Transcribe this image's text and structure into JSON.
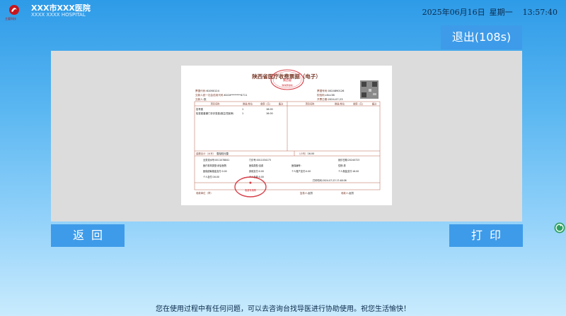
{
  "header": {
    "logo_caption": "主要科技",
    "hospital_name": "XXX市XXX医院",
    "hospital_en": "XXXX XXXX HOSPITAL",
    "date": "2025年06月16日",
    "weekday": "星期一",
    "time": "13:57:40"
  },
  "exit_label": "退出(108s)",
  "invoice": {
    "title": "陕西省医疗收费票据（电子）",
    "seal_text": "陕西省",
    "seal_sub": "财政部监制",
    "left_meta": [
      {
        "label": "票据代码:",
        "value": "61060124"
      },
      {
        "label": "交款人统一社会信用代码:",
        "value": "6104********4711"
      },
      {
        "label": "交款人:",
        "value": "张"
      }
    ],
    "right_meta": [
      {
        "label": "票据号码:",
        "value": "0024890126"
      },
      {
        "label": "校验码:",
        "value": "c0cc38"
      },
      {
        "label": "开票日期:",
        "value": "2024-07-23"
      }
    ],
    "col_headers": [
      "项目名称",
      "数量/单位",
      "金额（元）",
      "备注",
      "项目名称",
      "数量/单位",
      "金额（元）",
      "备注"
    ],
    "rows": [
      {
        "name": "挂号费",
        "qty": "1",
        "amount": "16.00"
      },
      {
        "name": "检查费普通门诊诊查费(副主任医师)",
        "qty": "1",
        "amount": "16.00"
      }
    ],
    "total_label": "金额合计（大写）",
    "total_upper": "壹拾陆元整",
    "total_small_label": "（小写）",
    "total_small": "16.00",
    "other": [
      [
        "业务流水号:",
        "0011078841",
        "门诊号:",
        "0011034173",
        "就诊日期:",
        "20240723"
      ],
      [
        "医疗机构类型:",
        "综合医院",
        "医保类型:",
        "自费",
        "医保编号:",
        "",
        "性别:",
        "男"
      ],
      [
        "医保统筹基金支付:",
        "0.00",
        "其他支付:",
        "0.00",
        "个人账户支付:",
        "0.00",
        "个人现金支付:",
        "16.00"
      ],
      [
        "个人自付:",
        "16.00",
        "个人自费:",
        "0.00"
      ]
    ],
    "print_time_label": "打印时间:",
    "print_time": "2024-07-23 17:48:06",
    "bottom": [
      {
        "label": "收款单位（章）",
        "value": ""
      },
      {
        "label": "复核人:",
        "value": "赵芳"
      },
      {
        "label": "收款人:",
        "value": "赵芳"
      }
    ],
    "stamp_text": "收费专用章"
  },
  "back_label": "返回",
  "print_label": "打印",
  "footer_text": "您在使用过程中有任何问题，可以去咨询台找导医进行协助使用。祝您生活愉快！",
  "colors": {
    "button": "#3e9be9",
    "accent_red": "#c8161d"
  }
}
